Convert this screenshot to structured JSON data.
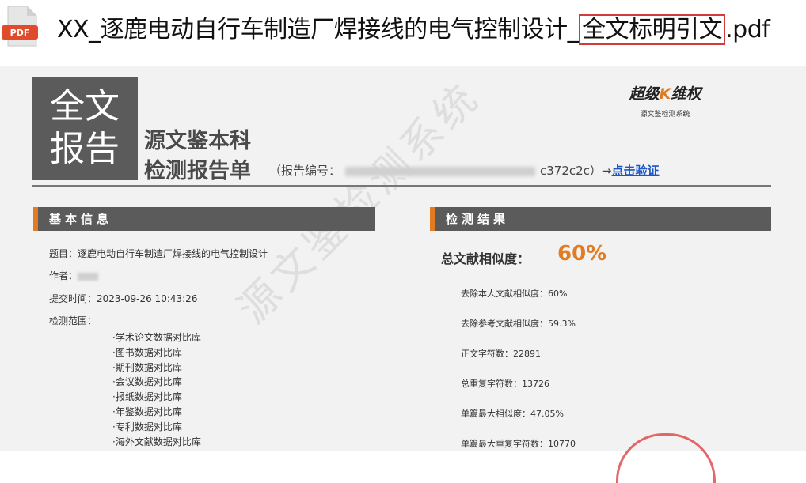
{
  "file": {
    "icon_label": "PDF",
    "title_prefix": "XX_逐鹿电动自行车制造厂焊接线的电气控制设计_",
    "title_highlight": "全文标明引文",
    "title_suffix": ".pdf"
  },
  "report": {
    "box_line1": "全文",
    "box_line2": "报告",
    "title_line1": "源文鉴本科",
    "title_line2": "检测报告单",
    "report_no_prefix": "（报告编号：",
    "report_no_tail": "c372c2c）→",
    "verify_link": "点击验证",
    "brand_part1": "超级",
    "brand_k": "K",
    "brand_part2": "维权",
    "brand_sub": "源文鉴检测系统",
    "watermark": "源文鉴检测系统"
  },
  "basic_info": {
    "header": "基本信息",
    "topic": "题目：逐鹿电动自行车制造厂焊接线的电气控制设计",
    "author_label": "作者：",
    "submit_time": "提交时间：2023-09-26 10:43:26",
    "scope_label": "检测范围：",
    "databases": [
      "·学术论文数据对比库",
      "·图书数据对比库",
      "·期刊数据对比库",
      "·会议数据对比库",
      "·报纸数据对比库",
      "·年鉴数据对比库",
      "·专利数据对比库",
      "·海外文献数据对比库"
    ]
  },
  "results": {
    "header": "检测结果",
    "total_label": "总文献相似度：",
    "total_value": "60%",
    "stats": [
      "去除本人文献相似度：60%",
      "去除参考文献相似度：59.3%",
      "正文字符数：22891",
      "总重复字符数：13726",
      "单篇最大相似度：47.05%",
      "单篇最大重复字符数：10770"
    ]
  },
  "colors": {
    "accent": "#e37b22",
    "bar": "#5b5b5b",
    "highlight_border": "#d23b3b",
    "link": "#1a56c8"
  }
}
